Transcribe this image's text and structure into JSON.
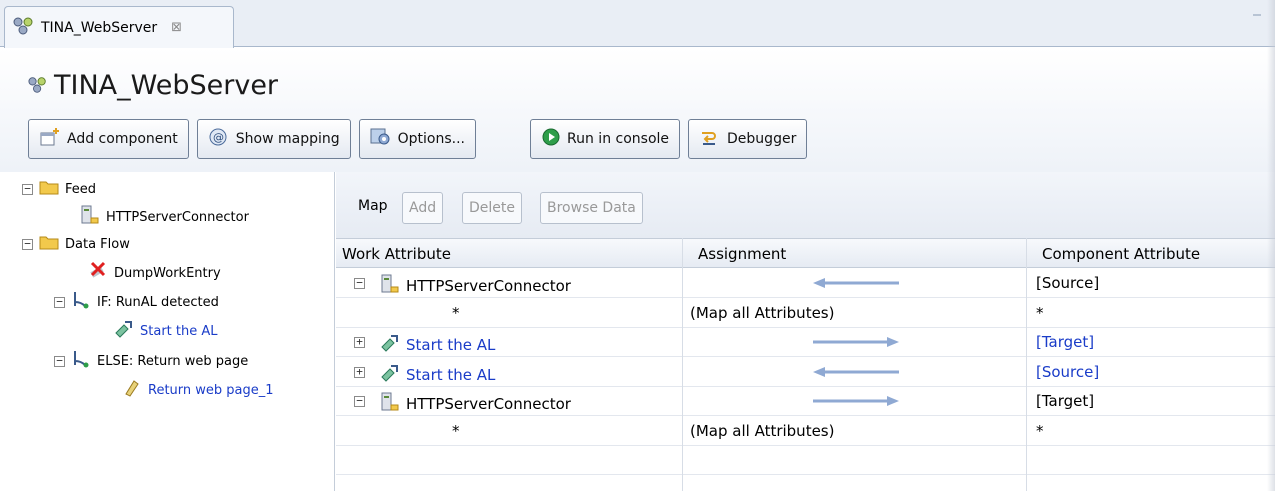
{
  "tab": {
    "label": "TINA_WebServer",
    "close_glyph": "⊠"
  },
  "title": "TINA_WebServer",
  "toolbar": {
    "add_component": "Add component",
    "show_mapping": "Show mapping",
    "options": "Options...",
    "run_console": "Run in console",
    "debugger": "Debugger"
  },
  "tree": {
    "feed": "Feed",
    "http_connector": "HTTPServerConnector",
    "data_flow": "Data Flow",
    "dump": "DumpWorkEntry",
    "if_branch": "IF: RunAL detected",
    "start_al": "Start the AL",
    "else_branch": "ELSE: Return web page",
    "return_page": "Return web page_1"
  },
  "map": {
    "label": "Map",
    "add": "Add",
    "delete": "Delete",
    "browse": "Browse Data",
    "columns": [
      "Work Attribute",
      "Assignment",
      "Component Attribute"
    ],
    "rows": [
      {
        "expander": "−",
        "work": "HTTPServerConnector",
        "assign": "",
        "comp": "[Source]",
        "dir": "left",
        "blue": false
      },
      {
        "expander": "",
        "work": "*",
        "assign": "(Map all Attributes)",
        "comp": "*",
        "dir": "",
        "blue": false
      },
      {
        "expander": "+",
        "work": "Start the AL",
        "assign": "",
        "comp": "[Target]",
        "dir": "right",
        "blue": true
      },
      {
        "expander": "+",
        "work": "Start the AL",
        "assign": "",
        "comp": "[Source]",
        "dir": "left",
        "blue": true
      },
      {
        "expander": "−",
        "work": "HTTPServerConnector",
        "assign": "",
        "comp": "[Target]",
        "dir": "right",
        "blue": false
      },
      {
        "expander": "",
        "work": "*",
        "assign": "(Map all Attributes)",
        "comp": "*",
        "dir": "",
        "blue": false
      }
    ]
  },
  "colors": {
    "link": "#1a3cc8",
    "arrow": "#8fa9d3",
    "folder": "#f2c94c"
  }
}
